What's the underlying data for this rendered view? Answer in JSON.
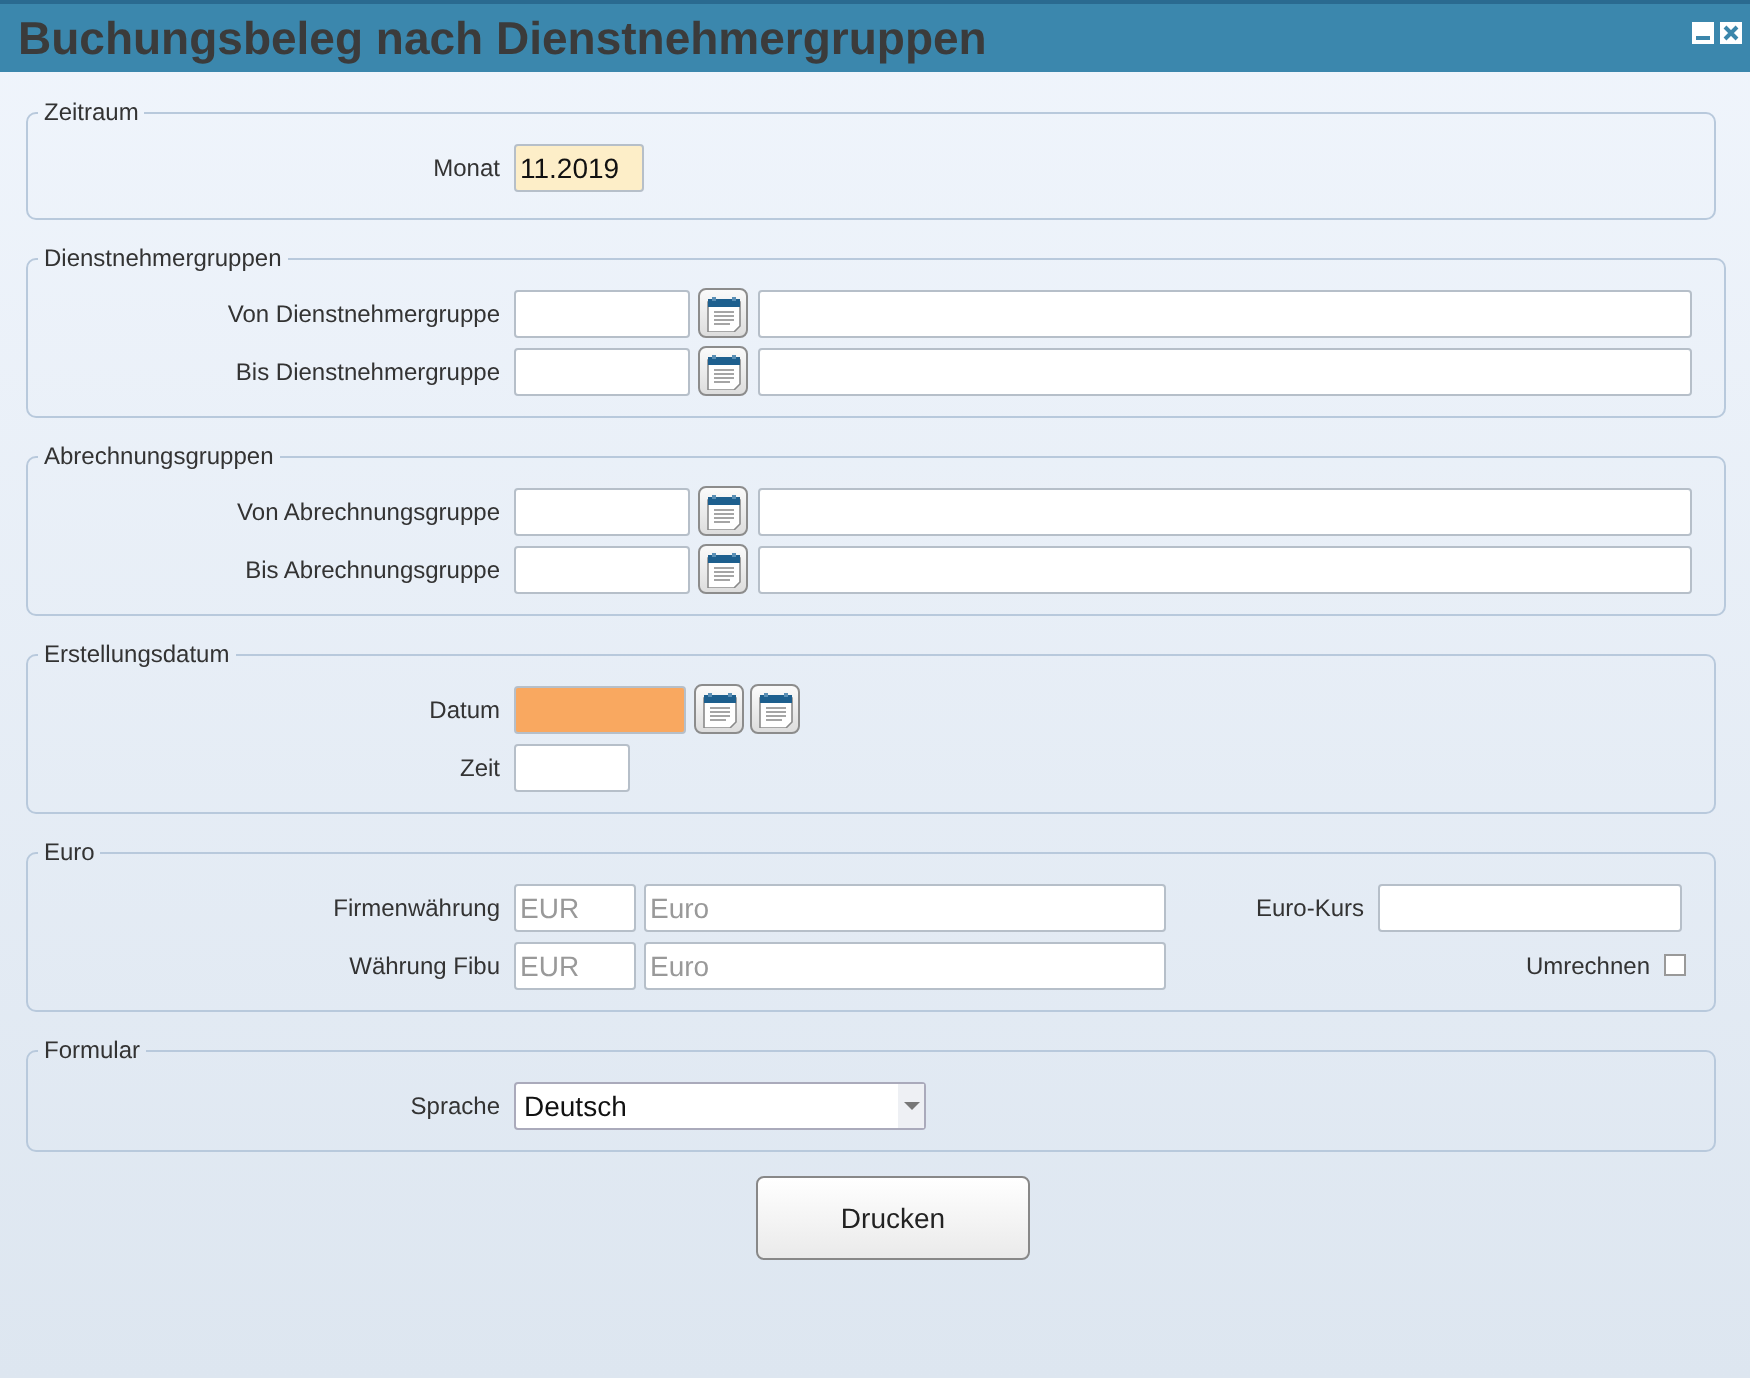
{
  "window": {
    "title": "Buchungsbeleg nach Dienstnehmergruppen"
  },
  "sections": [
    {
      "title": "Zeitraum",
      "rows": [
        {
          "label": "Monat",
          "fields": [
            {
              "kind": "period",
              "value": "11.2019",
              "highlighted": true
            }
          ]
        }
      ]
    },
    {
      "title": "Dienstnehmergruppen",
      "rows": [
        {
          "label": "Von Dienstnehmergruppe",
          "fields": [
            {
              "kind": "code"
            },
            {
              "kind": "calendar"
            },
            {
              "kind": "description"
            }
          ]
        },
        {
          "label": "Bis Dienstnehmergruppe",
          "fields": [
            {
              "kind": "code"
            },
            {
              "kind": "calendar"
            },
            {
              "kind": "description"
            }
          ]
        }
      ]
    },
    {
      "title": "Abrechnungsgruppen",
      "rows": [
        {
          "label": "Von Abrechnungsgruppe",
          "fields": [
            {
              "kind": "code"
            },
            {
              "kind": "calendar"
            },
            {
              "kind": "description"
            }
          ]
        },
        {
          "label": "Bis Abrechnungsgruppe",
          "fields": [
            {
              "kind": "code"
            },
            {
              "kind": "calendar"
            },
            {
              "kind": "description"
            }
          ]
        }
      ]
    },
    {
      "title": "Erstellungsdatum",
      "rows": [
        {
          "label": "Datum",
          "fields": [
            {
              "kind": "date",
              "required": true
            },
            {
              "kind": "calendar"
            },
            {
              "kind": "calendar"
            }
          ]
        },
        {
          "label": "Zeit",
          "fields": [
            {
              "kind": "time"
            }
          ]
        }
      ]
    },
    {
      "title": "Euro",
      "rows": [
        {
          "label": "Firmenwährung",
          "fields": [
            {
              "kind": "currency",
              "value": "EUR",
              "disabled": true
            },
            {
              "kind": "name",
              "value": "Euro",
              "disabled": true
            },
            {
              "kind": "label",
              "text": "Euro-Kurs"
            },
            {
              "kind": "rate"
            }
          ]
        },
        {
          "label": "Währung Fibu",
          "fields": [
            {
              "kind": "currency",
              "value": "EUR",
              "disabled": true
            },
            {
              "kind": "name",
              "value": "Euro",
              "disabled": true
            },
            {
              "kind": "label",
              "text": "Umrechnen"
            },
            {
              "kind": "checkbox",
              "checked": false
            }
          ]
        }
      ]
    },
    {
      "title": "Formular",
      "rows": [
        {
          "label": "Sprache",
          "fields": [
            {
              "kind": "select",
              "value": "Deutsch"
            }
          ]
        }
      ]
    }
  ],
  "buttons": [
    {
      "label": "Drucken"
    }
  ]
}
